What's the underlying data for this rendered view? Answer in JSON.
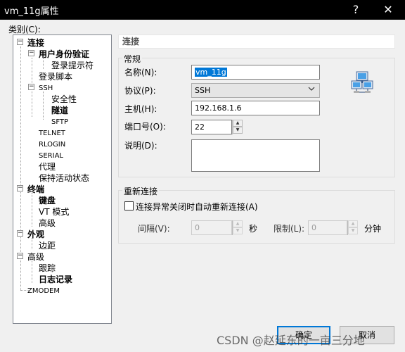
{
  "window": {
    "title": "vm_11g属性",
    "help_glyph": "?",
    "close_glyph": "✕"
  },
  "category_label": "类别(C):",
  "tree": {
    "connection": "连接",
    "user_auth": "用户身份验证",
    "login_prompt": "登录提示符",
    "login_script": "登录脚本",
    "ssh": "SSH",
    "security": "安全性",
    "tunnel": "隧道",
    "sftp": "SFTP",
    "telnet": "TELNET",
    "rlogin": "RLOGIN",
    "serial": "SERIAL",
    "proxy": "代理",
    "keepalive": "保持活动状态",
    "terminal": "终端",
    "keyboard": "键盘",
    "vt_mode": "VT 模式",
    "term_advanced": "高级",
    "appearance": "外观",
    "margin": "边距",
    "advanced": "高级",
    "trace": "跟踪",
    "log": "日志记录",
    "zmodem": "ZMODEM"
  },
  "panel": {
    "header": "连接",
    "general_group": "常规",
    "name_label": "名称(N):",
    "name_value": "vm_11g",
    "protocol_label": "协议(P):",
    "protocol_value": "SSH",
    "host_label": "主机(H):",
    "host_value": "192.168.1.6",
    "port_label": "端口号(O):",
    "port_value": "22",
    "desc_label": "说明(D):",
    "reconnect_group": "重新连接",
    "reconnect_checkbox": "连接异常关闭时自动重新连接(A)",
    "interval_label": "间隔(V):",
    "interval_value": "0",
    "sec_unit": "秒",
    "limit_label": "限制(L):",
    "limit_value": "0",
    "min_unit": "分钟"
  },
  "buttons": {
    "ok": "确定",
    "cancel": "取消"
  },
  "watermark": "CSDN @赵延东的一亩三分地"
}
